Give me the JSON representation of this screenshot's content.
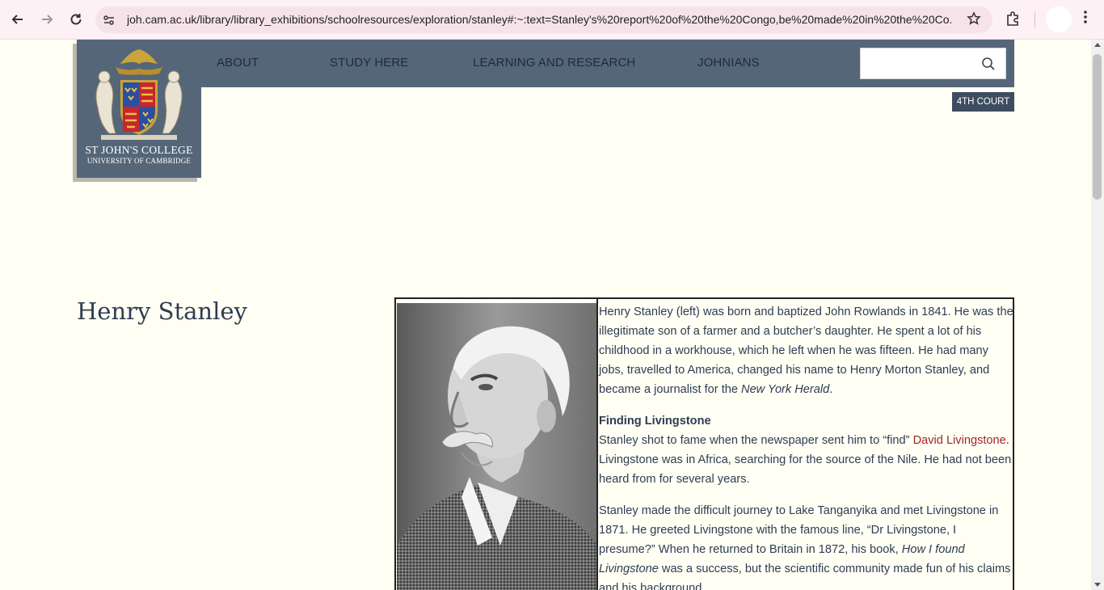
{
  "browser": {
    "url": "joh.cam.ac.uk/library/library_exhibitions/schoolresources/exploration/stanley#:~:text=Stanley's%20report%20of%20the%20Congo,be%20made%20in%20the%20Co...",
    "back_icon": "arrow-left-icon",
    "forward_icon": "arrow-right-icon",
    "reload_icon": "reload-icon",
    "star_icon": "star-icon",
    "extensions_icon": "puzzle-icon",
    "menu_icon": "kebab-menu-icon"
  },
  "site": {
    "logo_name": "ST JOHN'S COLLEGE",
    "logo_sub": "UNIVERSITY OF CAMBRIDGE",
    "nav": [
      {
        "label": "ABOUT"
      },
      {
        "label": "STUDY HERE"
      },
      {
        "label": "LEARNING AND RESEARCH"
      },
      {
        "label": "JOHNIANS"
      }
    ],
    "search_placeholder": "",
    "badge": "4TH COURT"
  },
  "page": {
    "title": "Henry Stanley",
    "p1_a": "Henry Stanley (left) was born and baptized John Rowlands in 1841. He was the illegitimate son of a farmer and a butcher’s daughter. He spent a lot of his childhood in a workhouse, which he left when he was fifteen. He had many jobs, travelled to America, changed his name to Henry Morton Stanley, and became a journalist for the ",
    "p1_em": "New York Herald",
    "p1_b": ".",
    "h2": "Finding Livingstone",
    "p2_a": "Stanley shot to fame when the newspaper sent him to “find” ",
    "p2_link": "David Livingstone",
    "p2_b": ". Livingstone was in Africa, searching for the source of the Nile. He had not been heard from for several years.",
    "p3_a": "Stanley made the difficult journey to Lake Tanganyika and met Livingstone in 1871. He greeted Livingstone with the famous line, “Dr Livingstone, I presume?” When he returned to Britain in 1872, his book, ",
    "p3_em": "How I found Livingstone",
    "p3_b": " was a success, but the scientific community made fun of his claims and his background."
  },
  "colors": {
    "nav_bg": "#566679",
    "page_bg": "#fffff4",
    "text": "#2e3d52",
    "link": "#a12626",
    "badge_bg": "#3e4c5f"
  }
}
